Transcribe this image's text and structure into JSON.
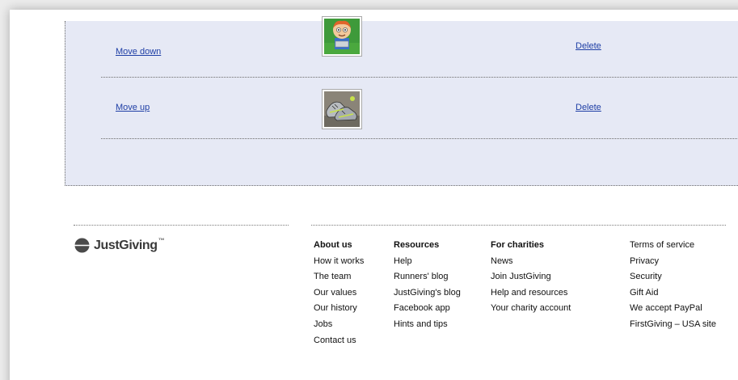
{
  "gallery": {
    "rows": [
      {
        "move_label": "Move down",
        "delete_label": "Delete"
      },
      {
        "move_label": "Move up",
        "delete_label": "Delete"
      }
    ]
  },
  "brand": {
    "name": "JustGiving",
    "tm": "™"
  },
  "footer": {
    "about": {
      "heading": "About us",
      "items": [
        "How it works",
        "The team",
        "Our values",
        "Our history",
        "Jobs",
        "Contact us"
      ]
    },
    "resources": {
      "heading": "Resources",
      "items": [
        "Help",
        "Runners' blog",
        "JustGiving's blog",
        "Facebook app",
        "Hints and tips"
      ]
    },
    "charities": {
      "heading": "For charities",
      "items": [
        "News",
        "Join JustGiving",
        "Help and resources",
        "Your charity account"
      ]
    },
    "legal": {
      "items": [
        "Terms of service",
        "Privacy",
        "Security",
        "Gift Aid",
        "We accept PayPal",
        "FirstGiving – USA site"
      ]
    }
  }
}
